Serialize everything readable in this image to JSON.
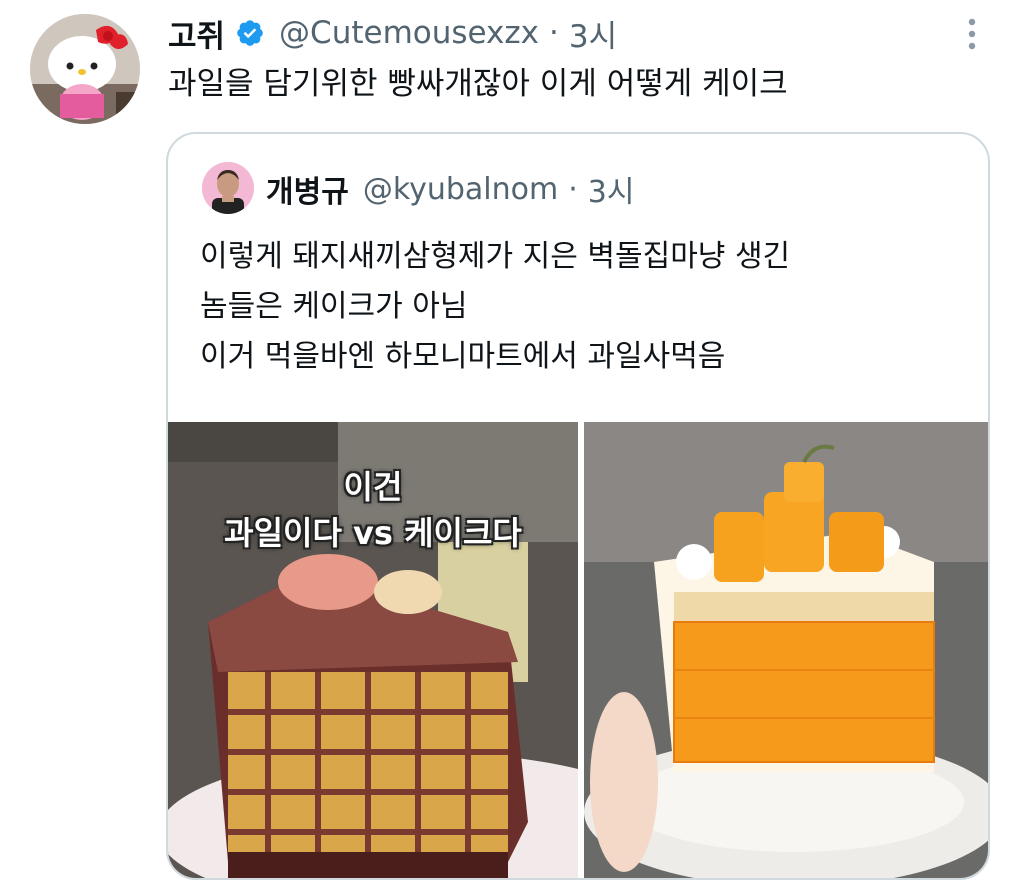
{
  "tweet": {
    "display_name": "고쥐",
    "handle": "@Cutemousexzx",
    "separator": "·",
    "time": "3시",
    "text": "과일을 담기위한 빵싸개잖아 이게 어떻게 케이크"
  },
  "quote": {
    "display_name": "개병규",
    "handle": "@kyubalnom",
    "separator": "·",
    "time": "3시",
    "lines": [
      "이렇게 돼지새끼삼형제가 지은 벽돌집마냥 생긴",
      "놈들은 케이크가 아님",
      "이거 먹을바엔 하모니마트에서 과일사먹음"
    ]
  },
  "media": {
    "left_caption_line1": "이건",
    "left_caption_line2": "과일이다 vs 케이크다"
  },
  "colors": {
    "verified": "#1d9bf0",
    "secondary_text": "#536471",
    "border": "#cfd9de"
  },
  "icons": {
    "verified": "verified-badge-icon",
    "more": "more-vertical-icon"
  }
}
